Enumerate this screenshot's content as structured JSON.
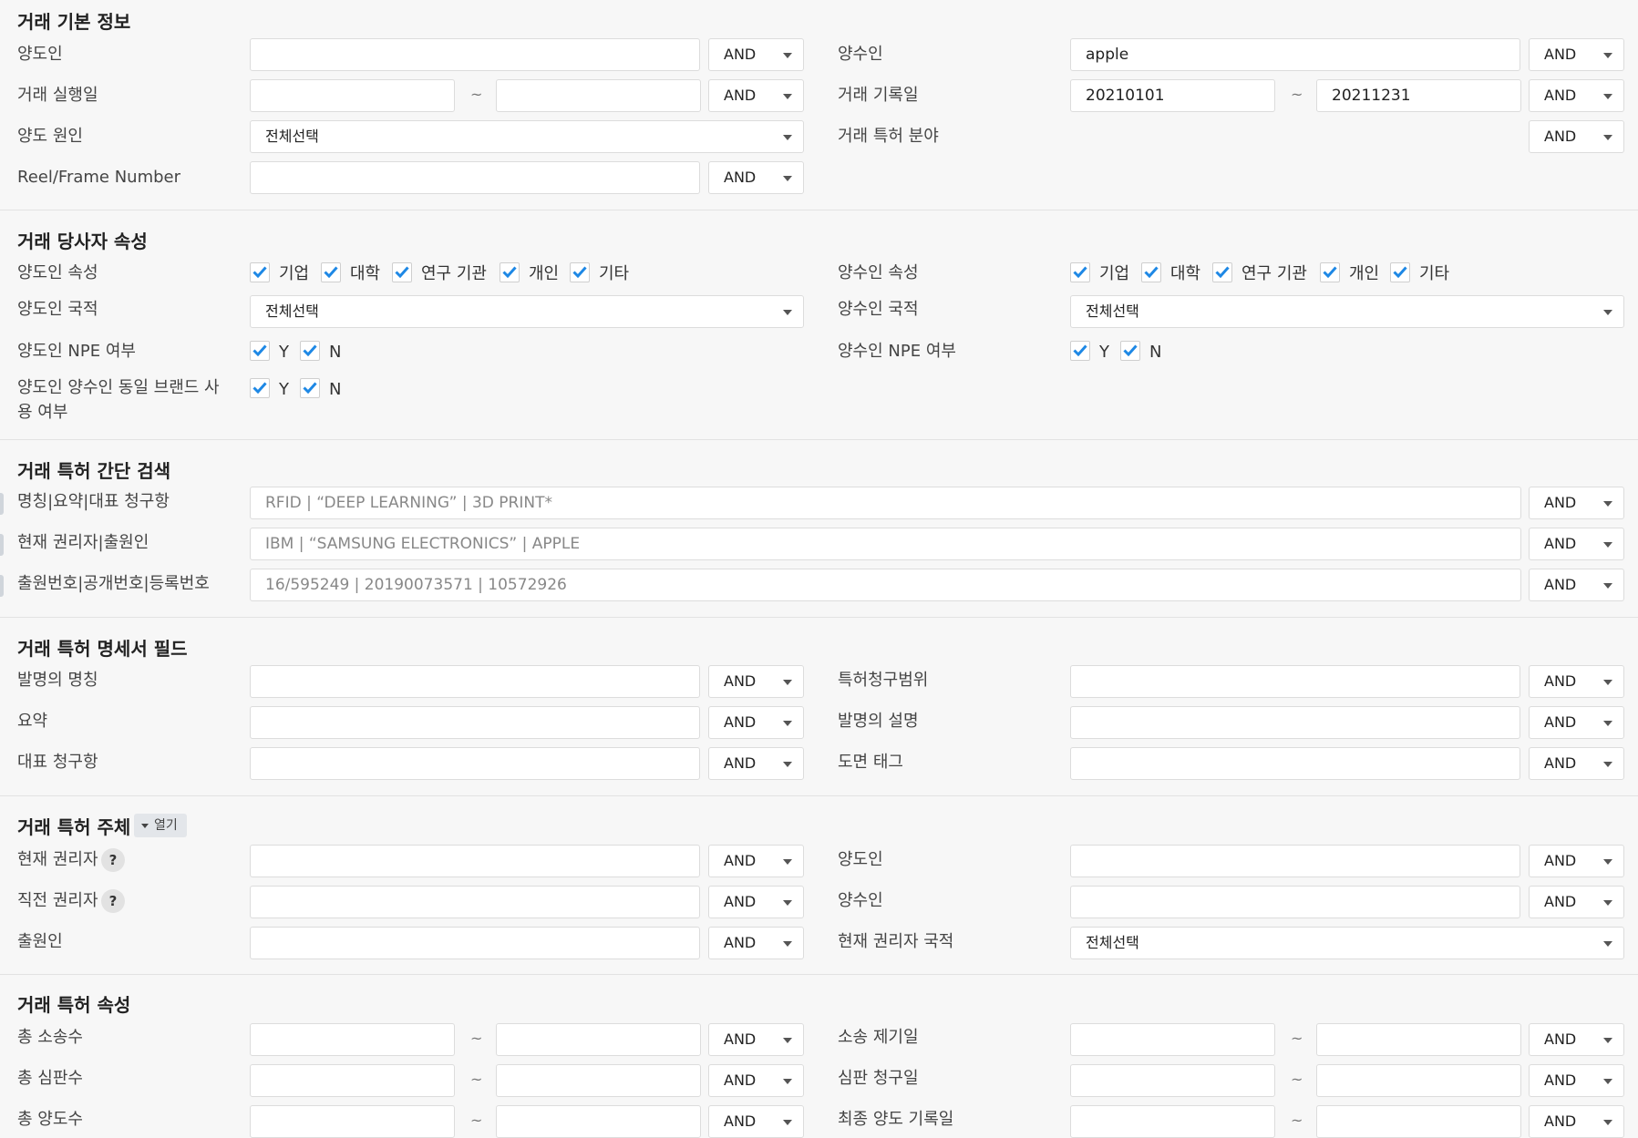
{
  "op": "AND",
  "sections": {
    "basic": {
      "title": "거래 기본 정보",
      "assignor": "양도인",
      "assignee": "양수인",
      "assignee_value": "apple",
      "exec_date": "거래 실행일",
      "record_date": "거래 기록일",
      "record_from": "20210101",
      "record_to": "20211231",
      "cause": "양도 원인",
      "cause_value": "전체선택",
      "field": "거래 특허 분야",
      "reel": "Reel/Frame Number",
      "tilde": "~"
    },
    "party": {
      "title": "거래 당사자 속성",
      "assignor_attr": "양도인 속성",
      "assignee_attr": "양수인 속성",
      "attr_options": [
        "기업",
        "대학",
        "연구 기관",
        "개인",
        "기타"
      ],
      "assignor_nat": "양도인 국적",
      "assignee_nat": "양수인 국적",
      "nat_value": "전체선택",
      "assignor_npe": "양도인 NPE 여부",
      "assignee_npe": "양수인 NPE 여부",
      "same_brand": "양도인 양수인 동일 브랜드 사용 여부",
      "yn": [
        "Y",
        "N"
      ]
    },
    "simple": {
      "title": "거래 특허 간단 검색",
      "row1_label": "명칭|요약|대표 청구항",
      "row1_placeholder": "RFID | “DEEP LEARNING” | 3D PRINT*",
      "row2_label": "현재 권리자|출원인",
      "row2_placeholder": "IBM | “SAMSUNG ELECTRONICS” | APPLE",
      "row3_label": "출원번호|공개번호|등록번호",
      "row3_placeholder": "16/595249 | 20190073571 | 10572926"
    },
    "spec": {
      "title": "거래 특허 명세서 필드",
      "invention_title": "발명의 명칭",
      "claims_scope": "특허청구범위",
      "abstract": "요약",
      "description": "발명의 설명",
      "rep_claim": "대표 청구항",
      "drawing_tag": "도면 태그"
    },
    "subject": {
      "title": "거래 특허 주체",
      "toggle": "열기",
      "current_owner": "현재 권리자",
      "assignor": "양도인",
      "prev_owner": "직전 권리자",
      "assignee": "양수인",
      "applicant": "출원인",
      "owner_nat": "현재 권리자 국적",
      "nat_value": "전체선택",
      "help": "?"
    },
    "attrs": {
      "title": "거래 특허 속성",
      "lit_count": "총 소송수",
      "lit_date": "소송 제기일",
      "trial_count": "총 심판수",
      "trial_date": "심판 청구일",
      "assign_count": "총 양도수",
      "last_assign": "최종 양도 기록일"
    }
  }
}
